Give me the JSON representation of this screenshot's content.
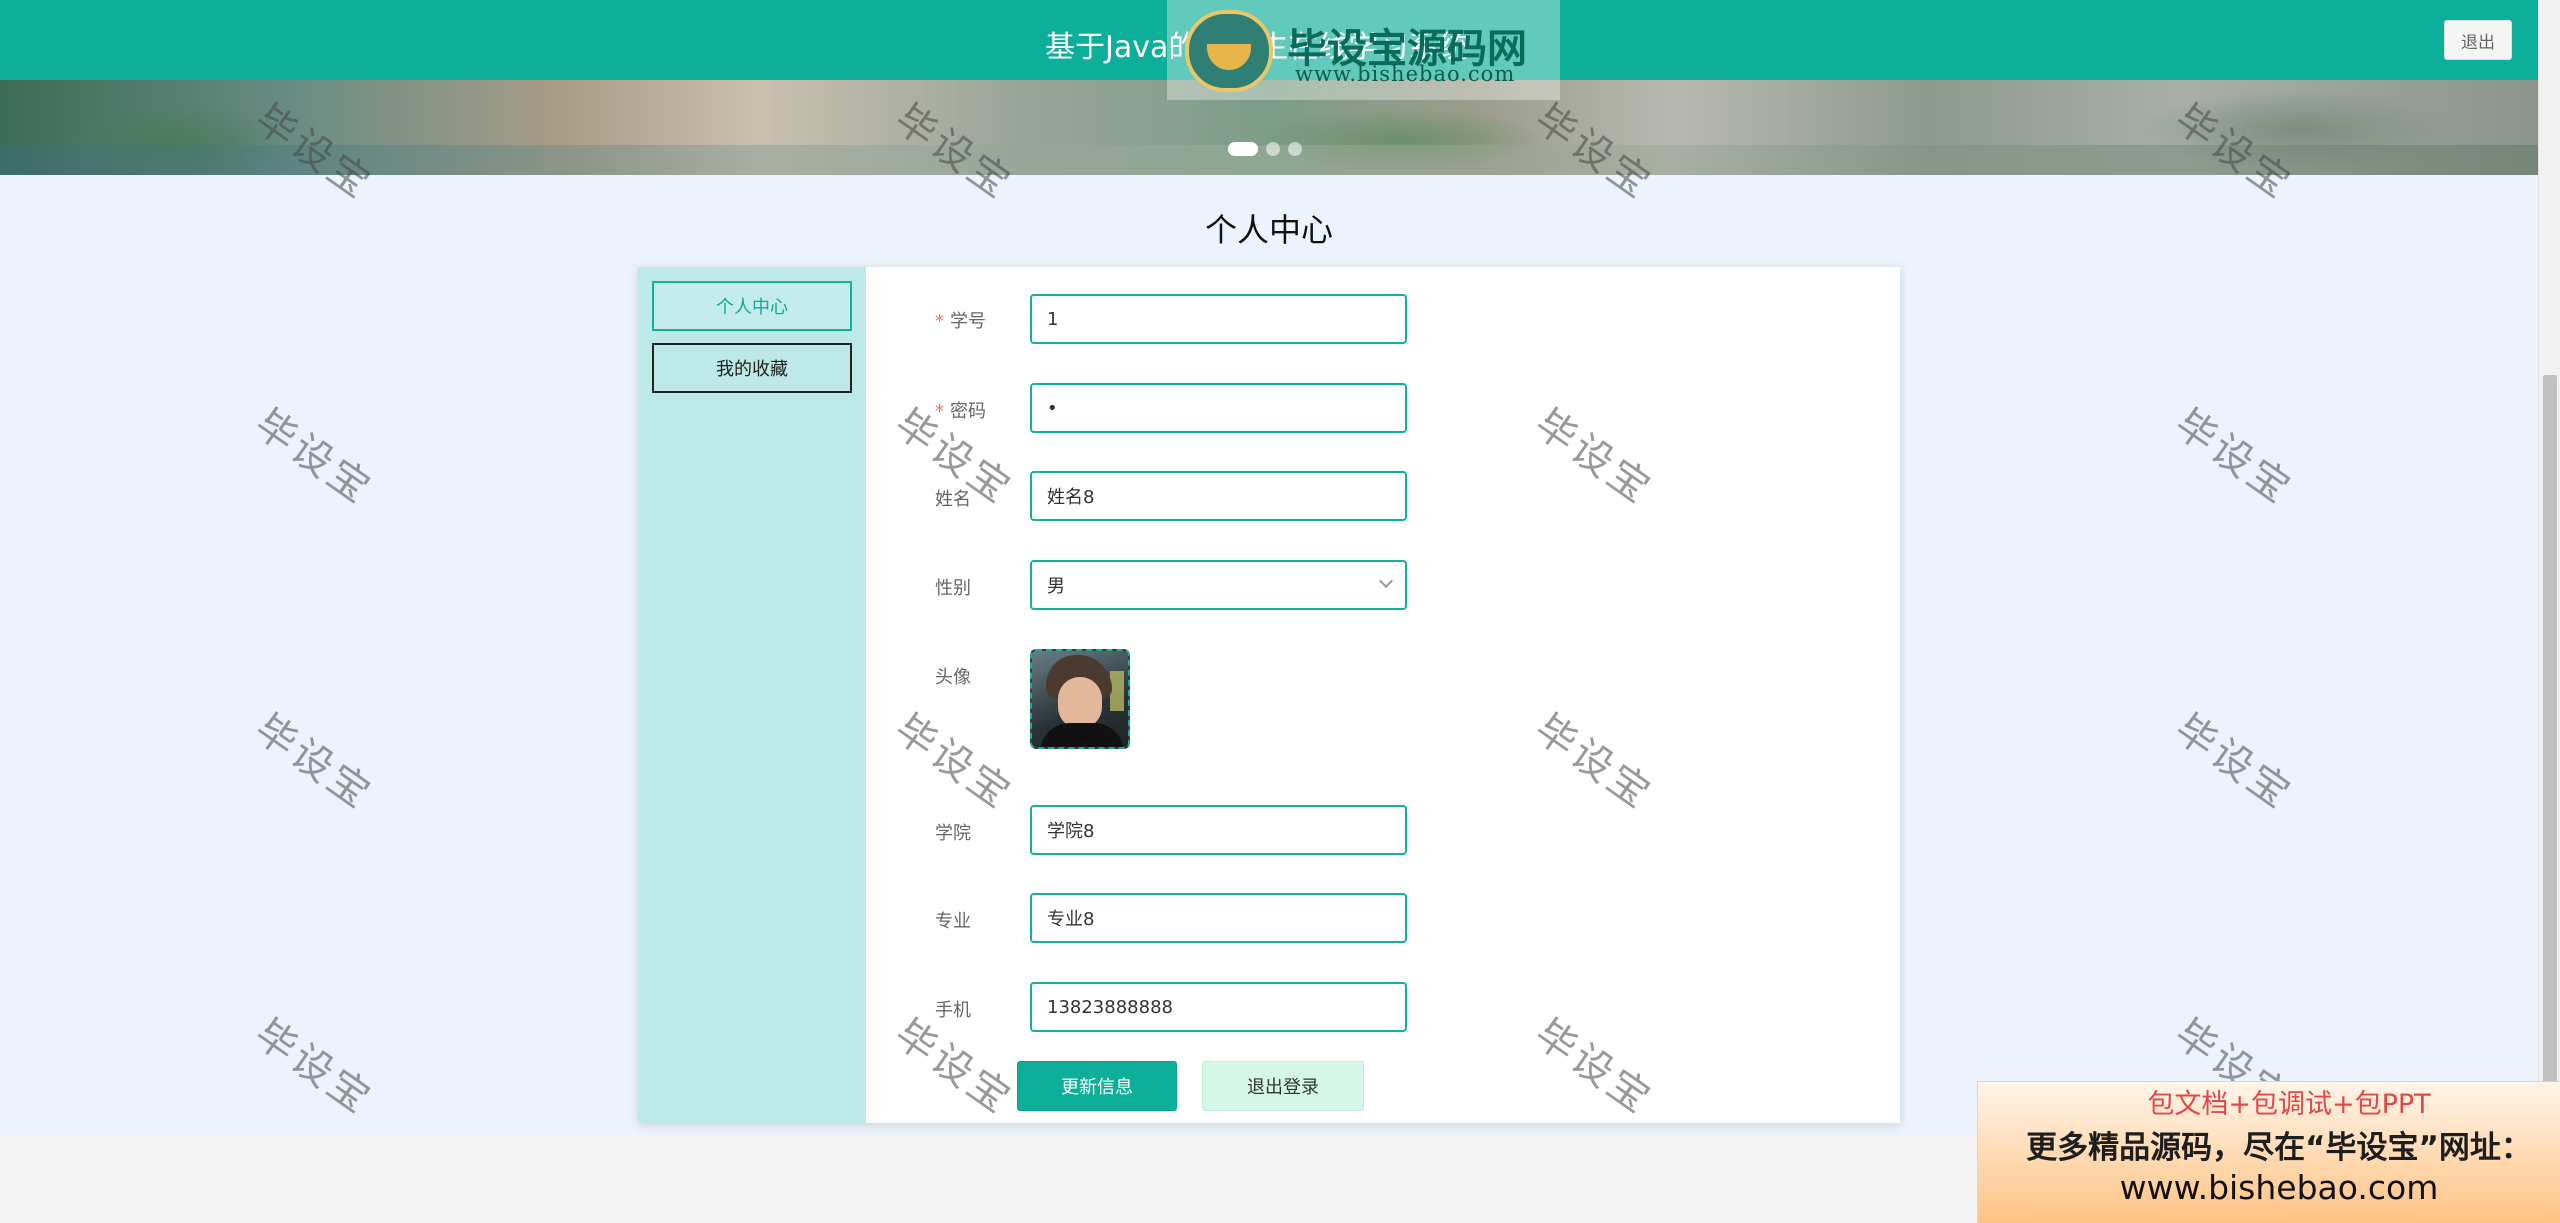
{
  "header": {
    "title": "基于Java的大学生在线学习系统",
    "logout_label": "退出"
  },
  "watermark_logo": {
    "name": "毕设宝源码网",
    "url": "www.bishebao.com"
  },
  "banner": {
    "dots": 3,
    "active_index": 0
  },
  "page": {
    "title": "个人中心"
  },
  "sidebar": {
    "items": [
      {
        "label": "个人中心",
        "active": true
      },
      {
        "label": "我的收藏",
        "active": false
      }
    ]
  },
  "form": {
    "student_id": {
      "label": "学号",
      "required": true,
      "value": "1"
    },
    "password": {
      "label": "密码",
      "required": true,
      "value": "•"
    },
    "name": {
      "label": "姓名",
      "value": "姓名8"
    },
    "gender": {
      "label": "性别",
      "value": "男"
    },
    "avatar": {
      "label": "头像"
    },
    "college": {
      "label": "学院",
      "value": "学院8"
    },
    "major": {
      "label": "专业",
      "value": "专业8"
    },
    "phone": {
      "label": "手机",
      "value": "13823888888"
    }
  },
  "actions": {
    "update_label": "更新信息",
    "logout_label": "退出登录"
  },
  "overlay_watermark": {
    "text": "毕设宝"
  },
  "promo": {
    "line1": "包文档+包调试+包PPT",
    "line2": "更多精品源码，尽在“毕设宝”网址：",
    "line3": "www.bishebao.com"
  },
  "colors": {
    "primary": "#0dae9a",
    "sidebar_bg": "#bde9e8",
    "page_bg": "#edf3fc",
    "required": "#f56c6c"
  }
}
